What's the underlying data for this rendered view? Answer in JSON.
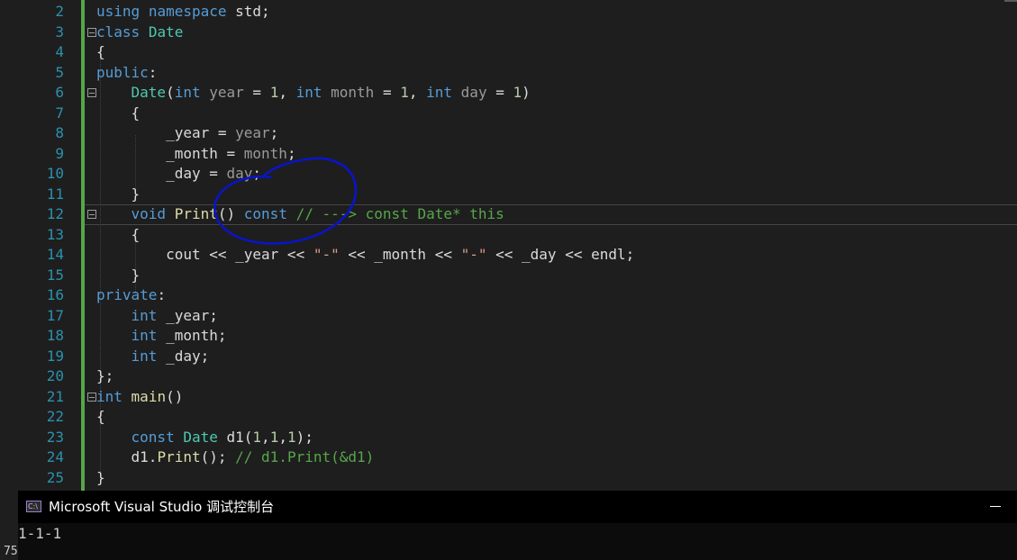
{
  "editor": {
    "lines": [
      {
        "n": "2",
        "t": "using namespace std;"
      },
      {
        "n": "3",
        "t": "class Date"
      },
      {
        "n": "4",
        "t": "{"
      },
      {
        "n": "5",
        "t": "public:"
      },
      {
        "n": "6",
        "t": "Date(int year = 1, int month = 1, int day = 1)"
      },
      {
        "n": "7",
        "t": "{"
      },
      {
        "n": "8",
        "t": "_year = year;"
      },
      {
        "n": "9",
        "t": "_month = month;"
      },
      {
        "n": "10",
        "t": "_day = day;"
      },
      {
        "n": "11",
        "t": "}"
      },
      {
        "n": "12",
        "t": "void Print() const // ---> const Date* this"
      },
      {
        "n": "13",
        "t": "{"
      },
      {
        "n": "14",
        "t": "cout << _year << \"-\" << _month << \"-\" << _day << endl;"
      },
      {
        "n": "15",
        "t": "}"
      },
      {
        "n": "16",
        "t": "private:"
      },
      {
        "n": "17",
        "t": "int _year;"
      },
      {
        "n": "18",
        "t": "int _month;"
      },
      {
        "n": "19",
        "t": "int _day;"
      },
      {
        "n": "20",
        "t": "};"
      },
      {
        "n": "21",
        "t": "int main()"
      },
      {
        "n": "22",
        "t": "{"
      },
      {
        "n": "23",
        "t": "const Date d1(1,1,1);"
      },
      {
        "n": "24",
        "t": "d1.Print(); // d1.Print(&d1)"
      },
      {
        "n": "25",
        "t": "}"
      }
    ]
  },
  "console": {
    "icon_label": "C:\\",
    "title": "Microsoft Visual Studio 调试控制台",
    "output": "1-1-1",
    "edge_text": "75"
  },
  "colors": {
    "keyword": "#569cd6",
    "type": "#4ec9b0",
    "comment": "#57a64a",
    "line_number": "#2b91af",
    "annotation_ink": "#0a14c8"
  }
}
